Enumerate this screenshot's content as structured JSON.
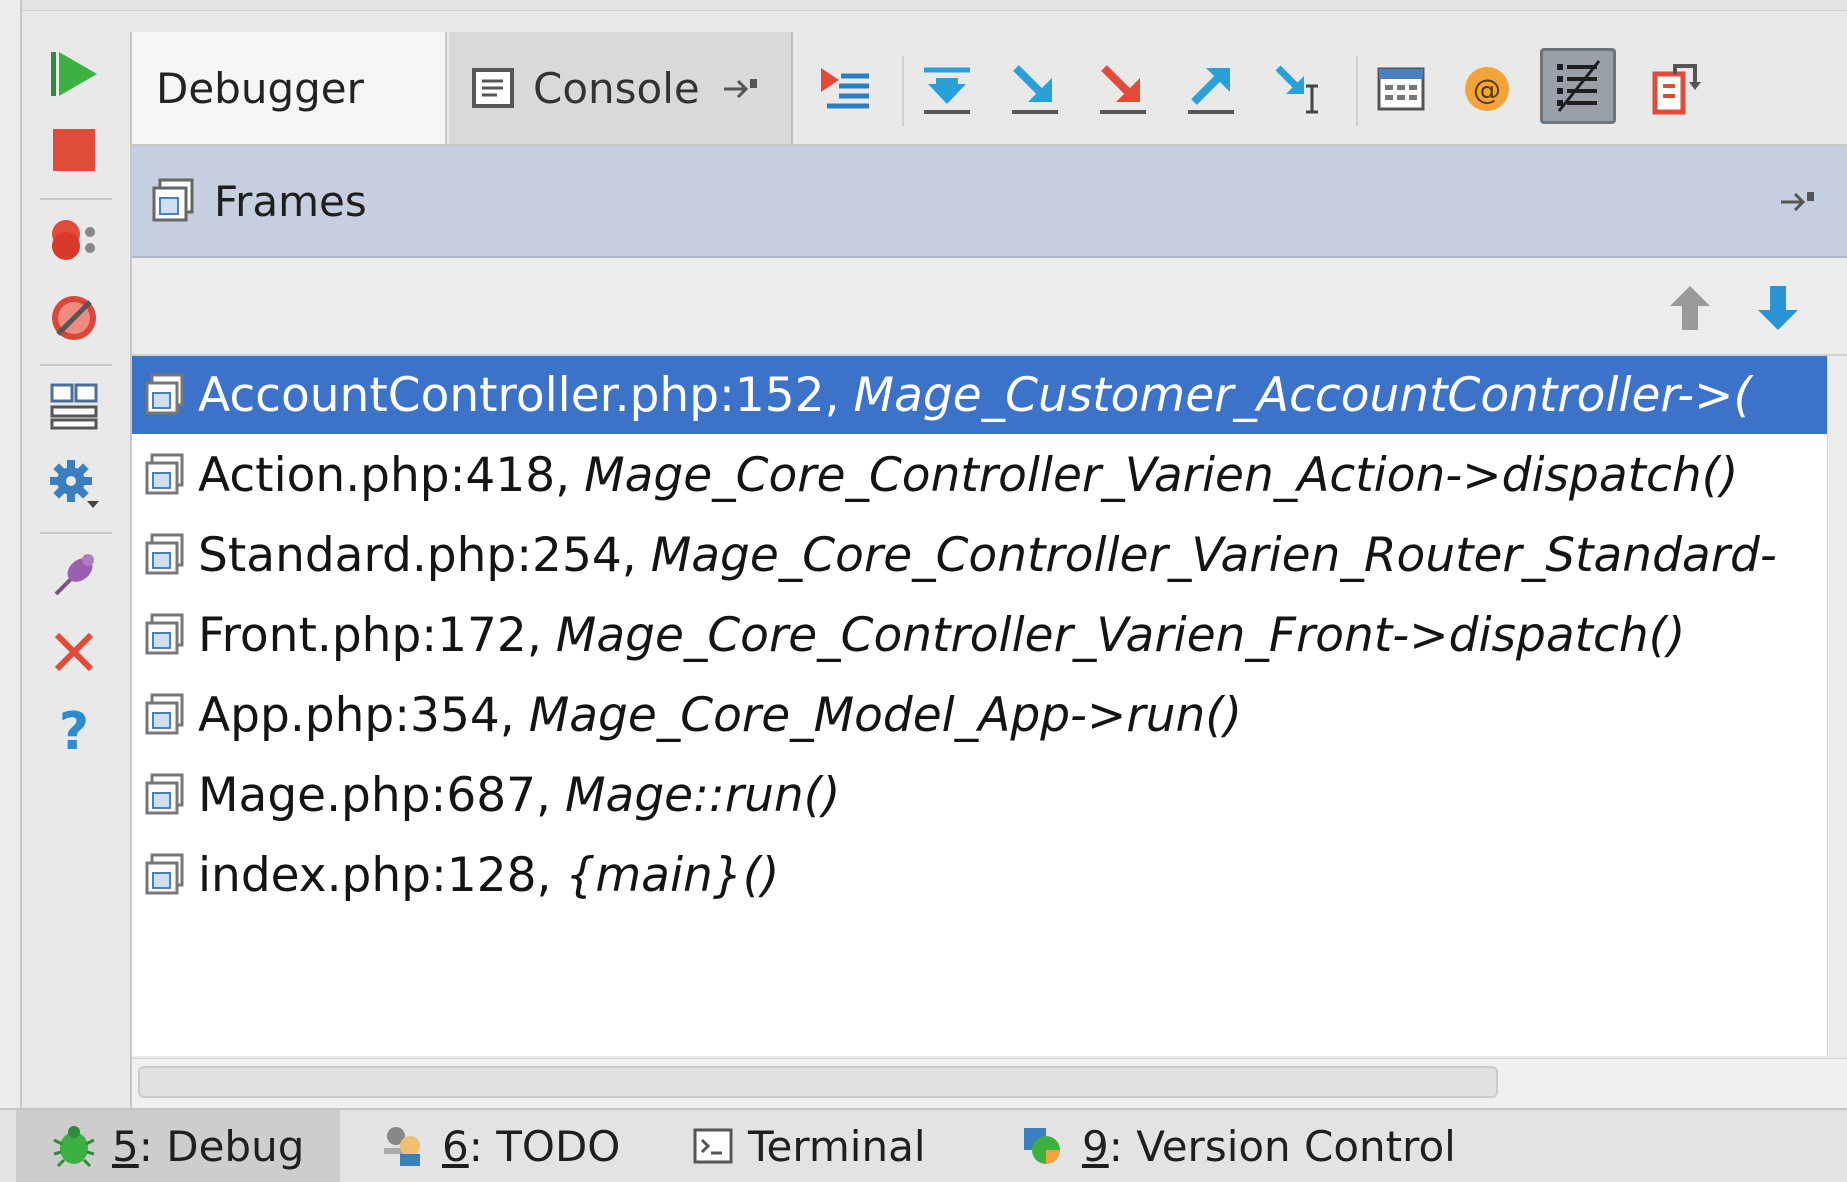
{
  "tabs": {
    "debugger_label": "Debugger",
    "console_label": "Console"
  },
  "frames_panel": {
    "title": "Frames",
    "rows": [
      {
        "location": "AccountController.php:152,",
        "method": "Mage_Customer_AccountController->(",
        "selected": true
      },
      {
        "location": "Action.php:418,",
        "method": "Mage_Core_Controller_Varien_Action->dispatch()",
        "selected": false
      },
      {
        "location": "Standard.php:254,",
        "method": "Mage_Core_Controller_Varien_Router_Standard-",
        "selected": false
      },
      {
        "location": "Front.php:172,",
        "method": "Mage_Core_Controller_Varien_Front->dispatch()",
        "selected": false
      },
      {
        "location": "App.php:354,",
        "method": "Mage_Core_Model_App->run()",
        "selected": false
      },
      {
        "location": "Mage.php:687,",
        "method": "Mage::run()",
        "selected": false
      },
      {
        "location": "index.php:128,",
        "method": "{main}()",
        "selected": false
      }
    ]
  },
  "bottom_tools": [
    {
      "num": "5",
      "label": ": Debug",
      "icon": "bug-icon",
      "active": true
    },
    {
      "num": "6",
      "label": ": TODO",
      "icon": "todo-icon",
      "active": false
    },
    {
      "num": "",
      "label": "Terminal",
      "icon": "terminal-icon",
      "active": false
    },
    {
      "num": "9",
      "label": ": Version Control",
      "icon": "version-control-icon",
      "active": false
    }
  ],
  "colors": {
    "selection": "#3c72c8",
    "panel_header": "#c5cfe0",
    "resume_green": "#3cb043",
    "stop_red": "#e04b3a",
    "step_blue": "#2aa0d8"
  }
}
